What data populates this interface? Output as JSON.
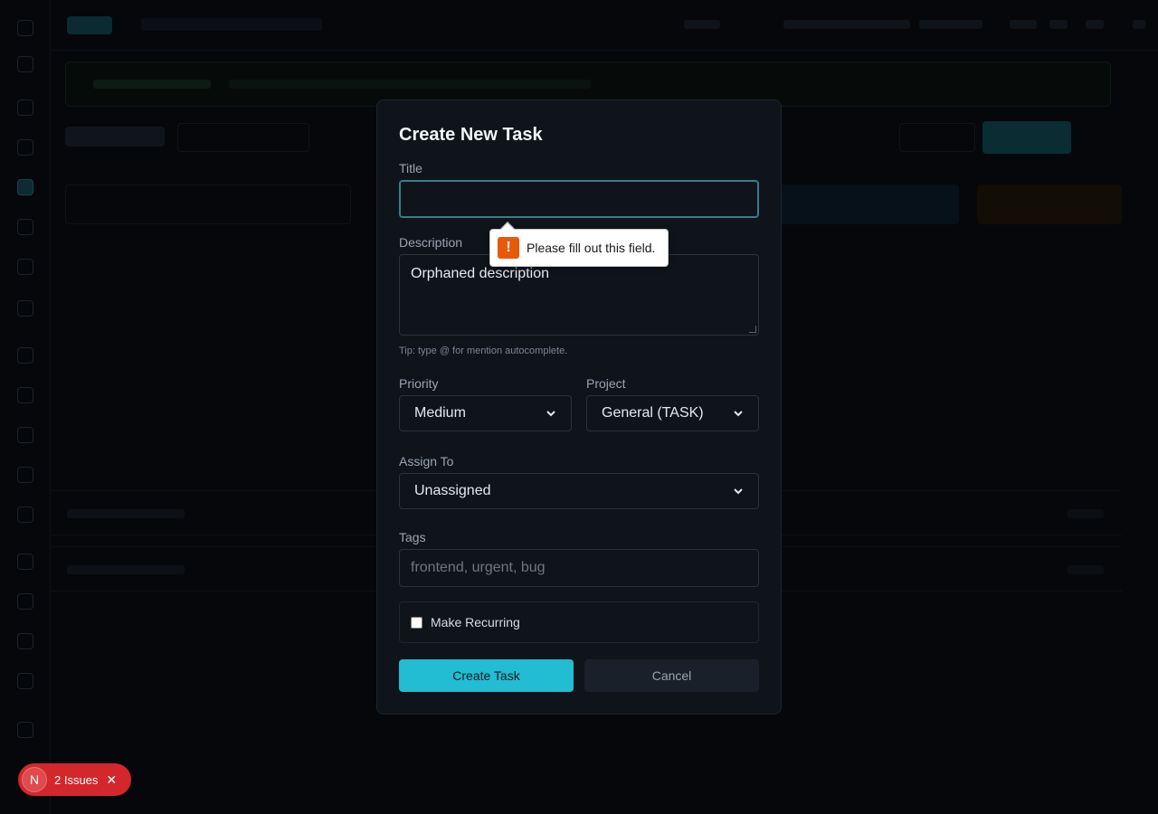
{
  "modal": {
    "title": "Create New Task",
    "title_label": "Title",
    "title_value": "",
    "description_label": "Description",
    "description_value": "Orphaned description",
    "tip": "Tip: type @ for mention autocomplete.",
    "priority_label": "Priority",
    "priority_value": "Medium",
    "project_label": "Project",
    "project_value": "General (TASK)",
    "assign_label": "Assign To",
    "assign_value": "Unassigned",
    "tags_label": "Tags",
    "tags_placeholder": "frontend, urgent, bug",
    "recurring_label": "Make Recurring",
    "recurring_checked": false,
    "create_label": "Create Task",
    "cancel_label": "Cancel"
  },
  "validation": {
    "message": "Please fill out this field.",
    "icon": "warning-icon",
    "icon_glyph": "!"
  },
  "issues": {
    "badge": "N",
    "label": "2 Issues",
    "close_glyph": "✕"
  },
  "colors": {
    "accent": "#22bcd3",
    "warning": "#e8590c",
    "danger": "#d3272c"
  }
}
